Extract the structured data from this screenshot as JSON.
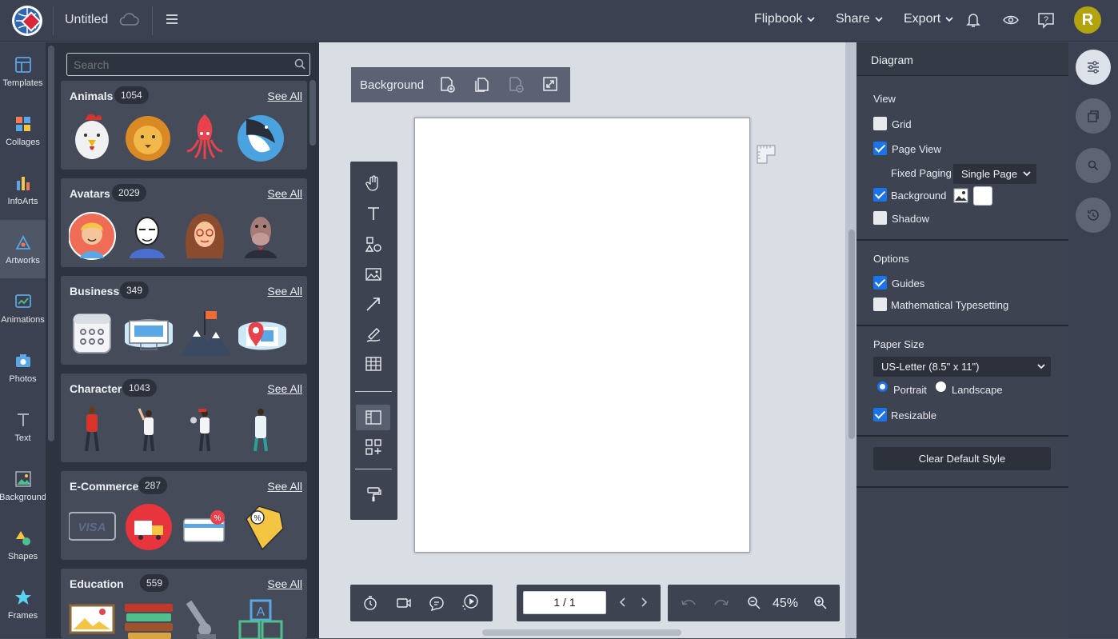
{
  "topbar": {
    "title": "Untitled",
    "menus": [
      "Flipbook",
      "Share",
      "Export"
    ],
    "avatar_letter": "R"
  },
  "rail": {
    "items": [
      {
        "label": "Templates",
        "icon": "templates-icon"
      },
      {
        "label": "Collages",
        "icon": "collages-icon"
      },
      {
        "label": "InfoArts",
        "icon": "infoarts-icon"
      },
      {
        "label": "Artworks",
        "icon": "artworks-icon",
        "active": true
      },
      {
        "label": "Animations",
        "icon": "animations-icon"
      },
      {
        "label": "Photos",
        "icon": "photos-icon"
      },
      {
        "label": "Text",
        "icon": "text-icon"
      },
      {
        "label": "Background",
        "icon": "background-icon"
      },
      {
        "label": "Shapes",
        "icon": "shapes-icon"
      },
      {
        "label": "Frames",
        "icon": "frames-icon"
      }
    ]
  },
  "library": {
    "search_placeholder": "Search",
    "see_all": "See All",
    "categories": [
      {
        "name": "Animals",
        "count": "1054"
      },
      {
        "name": "Avatars",
        "count": "2029"
      },
      {
        "name": "Business",
        "count": "349"
      },
      {
        "name": "Character",
        "count": "1043"
      },
      {
        "name": "E-Commerce",
        "count": "287"
      },
      {
        "name": "Education",
        "count": "559"
      }
    ]
  },
  "canvas": {
    "background_label": "Background",
    "page_indicator": "1 / 1",
    "zoom": "45%"
  },
  "props": {
    "header": "Diagram",
    "view_title": "View",
    "grid": "Grid",
    "page_view": "Page View",
    "fixed_paging": "Fixed Paging",
    "fixed_paging_value": "Single Page",
    "background": "Background",
    "shadow": "Shadow",
    "options_title": "Options",
    "guides": "Guides",
    "math_typesetting": "Mathematical Typesetting",
    "paper_size_title": "Paper Size",
    "paper_size_value": "US-Letter (8.5\" x 11\")",
    "portrait": "Portrait",
    "landscape": "Landscape",
    "resizable": "Resizable",
    "clear_default_style": "Clear Default Style"
  },
  "colors": {
    "accent": "#1a73e8",
    "avatar": "#b2a40f",
    "dark_panel": "#2e3340"
  }
}
